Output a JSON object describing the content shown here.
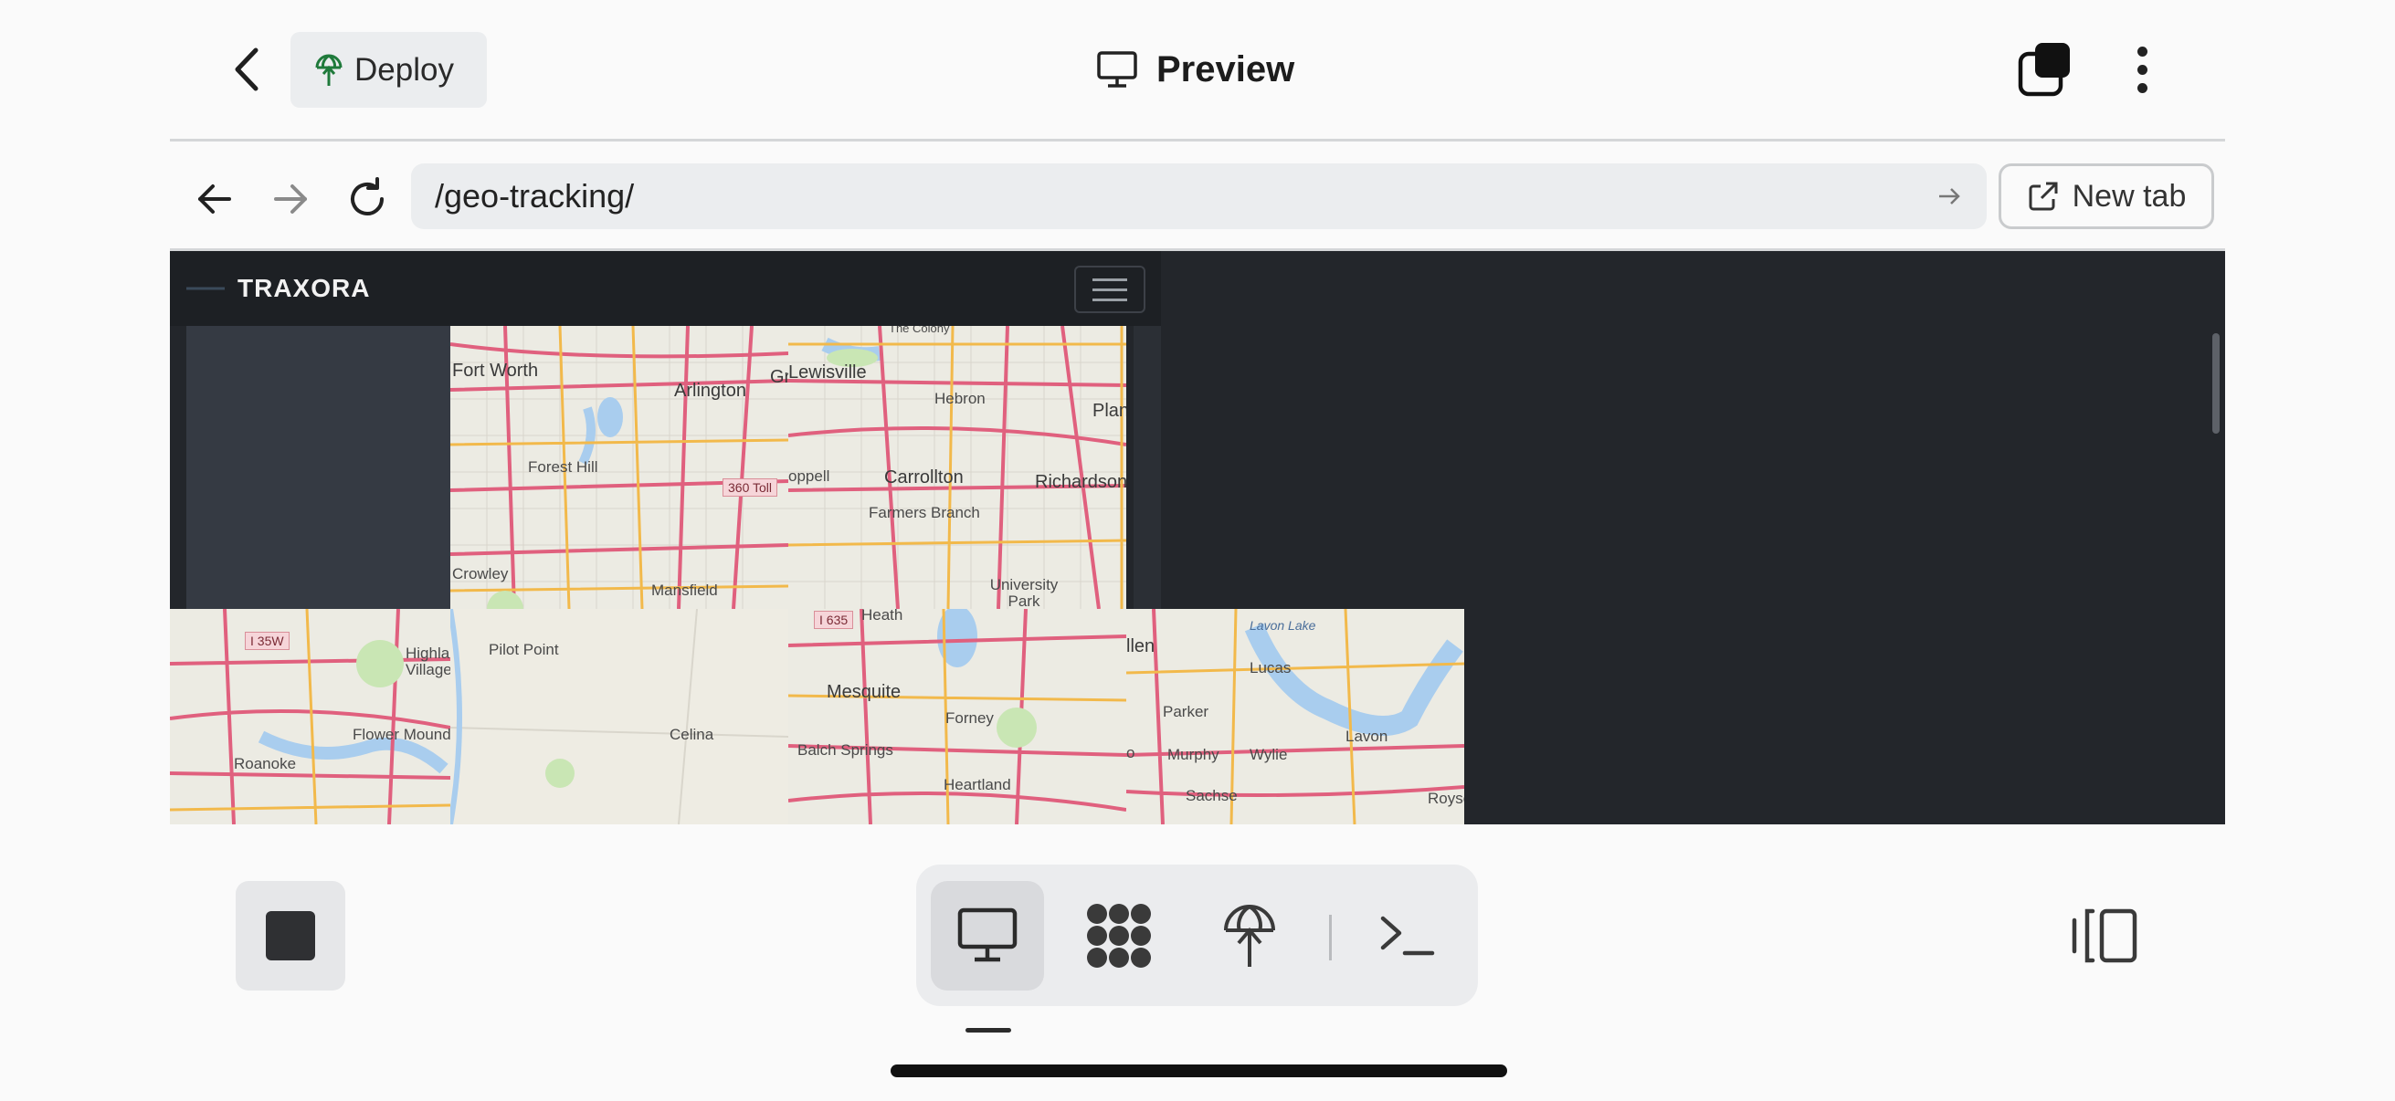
{
  "header": {
    "back_icon": "chevron-left-icon",
    "deploy_label": "Deploy",
    "deploy_icon": "deploy-globe-icon",
    "title": "Preview",
    "title_icon": "monitor-icon",
    "tabs_icon": "tabs-icon",
    "menu_icon": "kebab-menu-icon"
  },
  "browser": {
    "url": "/geo-tracking/",
    "new_tab_label": "New tab"
  },
  "app": {
    "brand": "TRAXORA"
  },
  "map": {
    "labels": {
      "fort_worth": "Fort Worth",
      "arlington": "Arlington",
      "gr": "Gr",
      "forest_hill": "Forest Hill",
      "crowley": "Crowley",
      "mansfield": "Mansfield",
      "toll360": "360 Toll",
      "lewisville": "Lewisville",
      "the_colony": "The Colony",
      "hebron": "Hebron",
      "plan": "Plan",
      "coppell": "oppell",
      "carrollton": "Carrollton",
      "richardson": "Richardson",
      "farmers_branch": "Farmers Branch",
      "university_park": "University Park",
      "heath": "Heath",
      "i35w": "I 35W",
      "highland_village": "Highla Village",
      "flower_mound": "Flower Mound",
      "roanoke": "Roanoke",
      "pilot_point": "Pilot Point",
      "celina": "Celina",
      "i635": "I 635",
      "mesquite": "Mesquite",
      "forney": "Forney",
      "balch_springs": "Balch Springs",
      "heartland": "Heartland",
      "allen": "llen",
      "lucas": "Lucas",
      "lavon_lake": "Lavon Lake",
      "parker": "Parker",
      "murphy": "Murphy",
      "wylie": "Wylie",
      "lavon": "Lavon",
      "sachse": "Sachse",
      "royse": "Royse",
      "o": "o"
    }
  },
  "bottom_bar": {
    "stop_icon": "stop-icon",
    "tools": [
      "monitor-icon",
      "agents-icon",
      "deploy-globe-icon",
      "terminal-icon"
    ],
    "panel_icon": "panel-toggle-icon"
  },
  "colors": {
    "frame_bg": "#23262b",
    "road_major": "#e0607e",
    "road_minor": "#f2b94b",
    "water": "#a9cdee",
    "park": "#c9e6b4"
  }
}
